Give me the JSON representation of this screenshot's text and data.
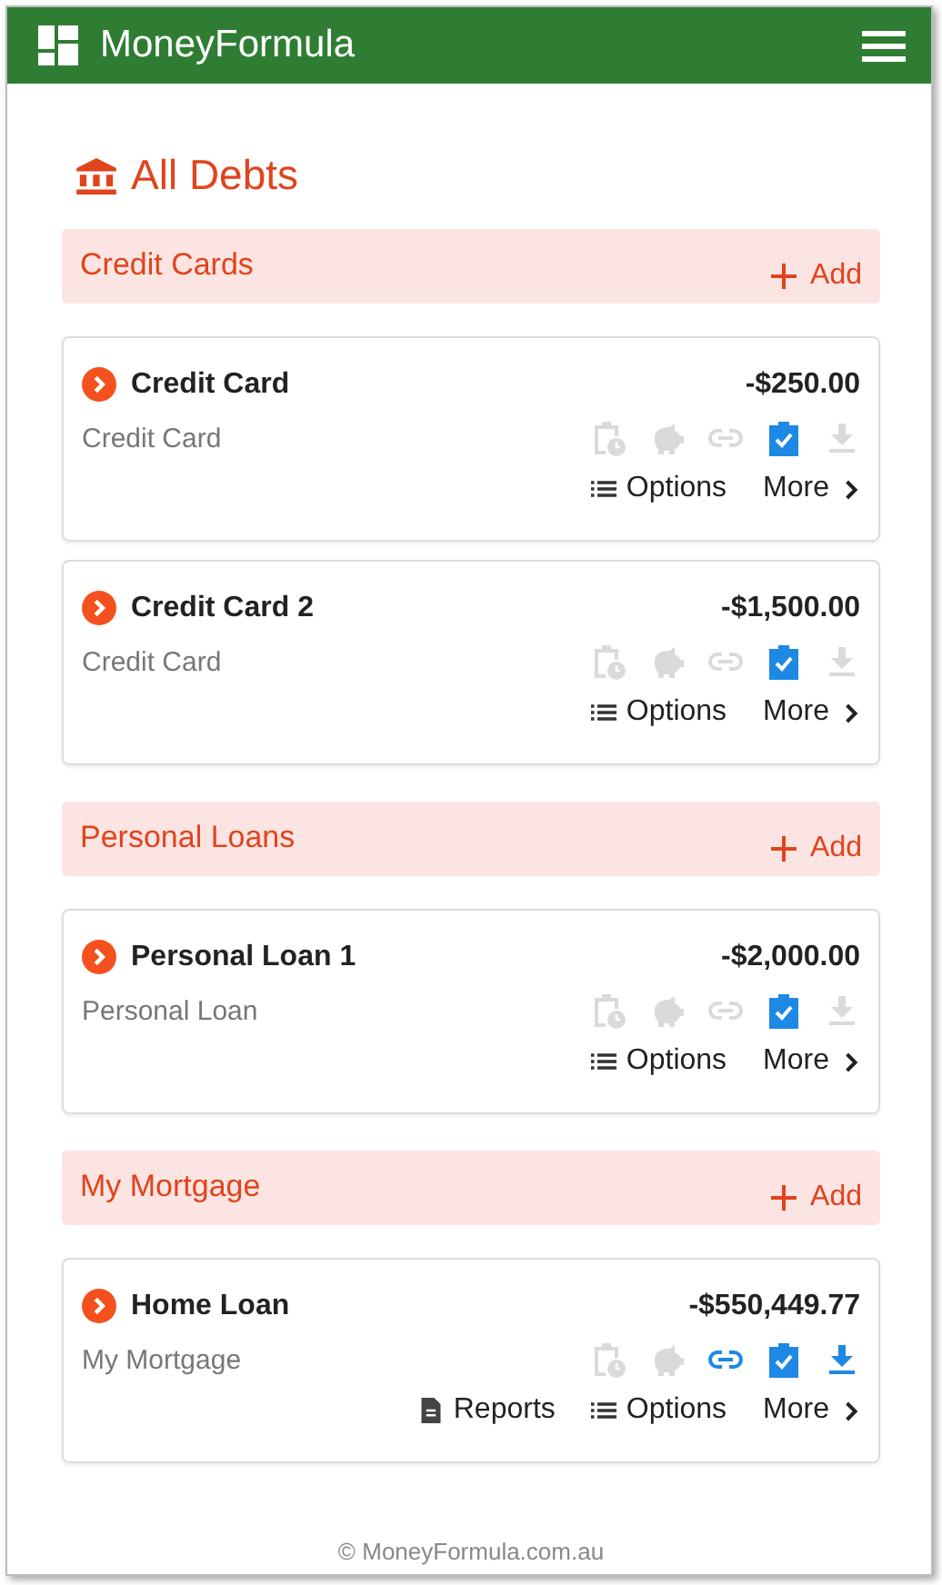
{
  "app": {
    "title": "MoneyFormula"
  },
  "page_title": "All Debts",
  "sections": [
    {
      "title": "Credit Cards",
      "add": "Add",
      "debts": [
        {
          "name": "Credit Card",
          "amount": "-$250.00",
          "type": "Credit Card",
          "icons": [
            {
              "kind": "schedule",
              "on": false
            },
            {
              "kind": "savings",
              "on": false
            },
            {
              "kind": "link",
              "on": false
            },
            {
              "kind": "checklist",
              "on": true
            },
            {
              "kind": "download",
              "on": false
            }
          ],
          "actions": [
            {
              "kind": "options",
              "label": "Options"
            },
            {
              "kind": "more",
              "label": "More"
            }
          ]
        },
        {
          "name": "Credit Card 2",
          "amount": "-$1,500.00",
          "type": "Credit Card",
          "icons": [
            {
              "kind": "schedule",
              "on": false
            },
            {
              "kind": "savings",
              "on": false
            },
            {
              "kind": "link",
              "on": false
            },
            {
              "kind": "checklist",
              "on": true
            },
            {
              "kind": "download",
              "on": false
            }
          ],
          "actions": [
            {
              "kind": "options",
              "label": "Options"
            },
            {
              "kind": "more",
              "label": "More"
            }
          ]
        }
      ]
    },
    {
      "title": "Personal Loans",
      "add": "Add",
      "debts": [
        {
          "name": "Personal Loan 1",
          "amount": "-$2,000.00",
          "type": "Personal Loan",
          "icons": [
            {
              "kind": "schedule",
              "on": false
            },
            {
              "kind": "savings",
              "on": false
            },
            {
              "kind": "link",
              "on": false
            },
            {
              "kind": "checklist",
              "on": true
            },
            {
              "kind": "download",
              "on": false
            }
          ],
          "actions": [
            {
              "kind": "options",
              "label": "Options"
            },
            {
              "kind": "more",
              "label": "More"
            }
          ]
        }
      ]
    },
    {
      "title": "My Mortgage",
      "add": "Add",
      "debts": [
        {
          "name": "Home Loan",
          "amount": "-$550,449.77",
          "type": "My Mortgage",
          "icons": [
            {
              "kind": "schedule",
              "on": false
            },
            {
              "kind": "savings",
              "on": false
            },
            {
              "kind": "link",
              "on": true
            },
            {
              "kind": "checklist",
              "on": true
            },
            {
              "kind": "download",
              "on": true
            }
          ],
          "actions": [
            {
              "kind": "reports",
              "label": "Reports"
            },
            {
              "kind": "options",
              "label": "Options"
            },
            {
              "kind": "more",
              "label": "More"
            }
          ]
        }
      ]
    }
  ],
  "footer": "© MoneyFormula.com.au"
}
